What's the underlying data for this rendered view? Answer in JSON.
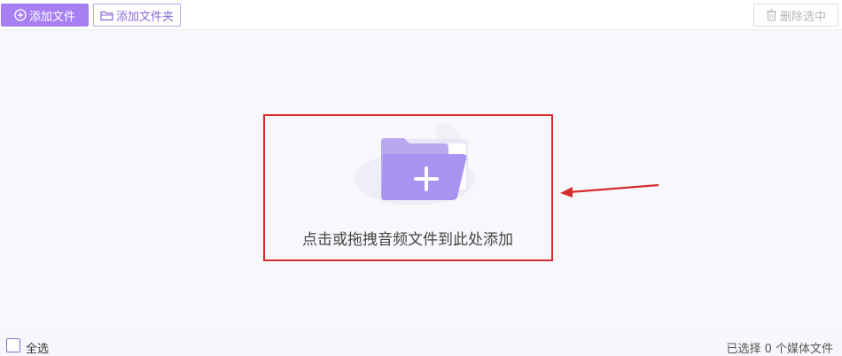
{
  "toolbar": {
    "add_file_label": "添加文件",
    "add_folder_label": "添加文件夹",
    "delete_selected_label": "删除选中"
  },
  "drop_zone": {
    "hint_text": "点击或拖拽音频文件到此处添加"
  },
  "footer": {
    "select_all_label": "全选",
    "status_text": "已选择 0 个媒体文件"
  },
  "colors": {
    "accent": "#a77ff2",
    "highlight_border": "#d42b2b",
    "annotation_arrow": "#d42b2b"
  }
}
